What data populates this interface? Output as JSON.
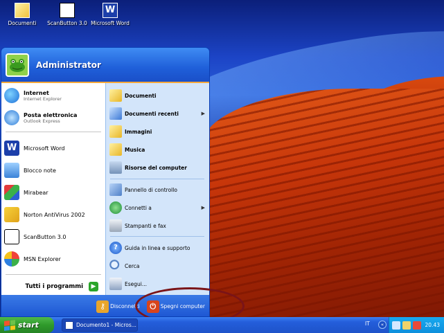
{
  "desktop": {
    "icons": [
      {
        "label": "Documenti",
        "icon": "documents-folder-icon"
      },
      {
        "label": "ScanButton 3.0",
        "icon": "scanbutton-icon"
      },
      {
        "label": "Microsoft Word",
        "icon": "word-icon"
      }
    ]
  },
  "start_menu": {
    "user": "Administrator",
    "pinned": [
      {
        "title": "Internet",
        "subtitle": "Internet Explorer",
        "icon": "internet-explorer-icon"
      },
      {
        "title": "Posta elettronica",
        "subtitle": "Outlook Express",
        "icon": "outlook-express-icon"
      }
    ],
    "recent": [
      {
        "label": "Microsoft Word",
        "icon": "word-icon"
      },
      {
        "label": "Blocco note",
        "icon": "notepad-icon"
      },
      {
        "label": "Mirabear",
        "icon": "mirabear-icon"
      },
      {
        "label": "Norton AntiVirus 2002",
        "icon": "norton-antivirus-icon"
      },
      {
        "label": "ScanButton 3.0",
        "icon": "scanbutton-icon"
      },
      {
        "label": "MSN Explorer",
        "icon": "msn-explorer-icon"
      }
    ],
    "all_programs": "Tutti i programmi",
    "places": [
      {
        "label": "Documenti",
        "icon": "documents-folder-icon",
        "bold": true
      },
      {
        "label": "Documenti recenti",
        "icon": "recent-documents-icon",
        "bold": true,
        "submenu": true
      },
      {
        "label": "Immagini",
        "icon": "pictures-folder-icon",
        "bold": true
      },
      {
        "label": "Musica",
        "icon": "music-folder-icon",
        "bold": true
      },
      {
        "label": "Risorse del computer",
        "icon": "my-computer-icon",
        "bold": true
      },
      {
        "label": "Pannello di controllo",
        "icon": "control-panel-icon"
      },
      {
        "label": "Connetti a",
        "icon": "connect-to-icon",
        "submenu": true
      },
      {
        "label": "Stampanti e fax",
        "icon": "printers-icon"
      },
      {
        "label": "Guida in linea e supporto",
        "icon": "help-icon"
      },
      {
        "label": "Cerca",
        "icon": "search-icon"
      },
      {
        "label": "Esegui...",
        "icon": "run-icon"
      }
    ],
    "logoff": "Disconnetti",
    "shutdown": "Spegni computer"
  },
  "taskbar": {
    "start_label": "start",
    "task": "Documento1 - Micros...",
    "language": "IT",
    "clock": "20.43"
  },
  "colors": {
    "start_button": "#2f9a2b",
    "taskbar": "#245edb",
    "tray": "#0e8fdc",
    "annotation_ring": "#7a1418"
  }
}
